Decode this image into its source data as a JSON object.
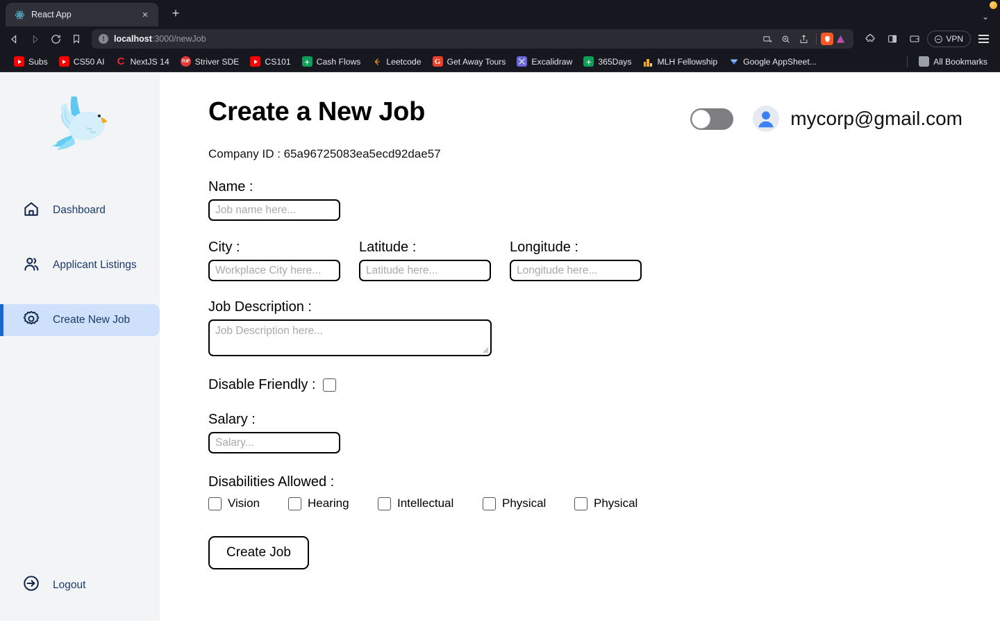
{
  "browser": {
    "tab": {
      "title": "React App",
      "favicon": "react-icon",
      "close_label": "×"
    },
    "new_tab_label": "+",
    "tabstrip_chevron": "⌄",
    "nav": {
      "back": "back-arrow-icon",
      "forward": "forward-arrow-icon",
      "reload": "reload-icon",
      "bookmark": "bookmark-icon"
    },
    "url": {
      "host": "localhost",
      "path": ":3000/newJob",
      "info_glyph": "!"
    },
    "vpn_label": "VPN",
    "bookmarks": [
      {
        "label": "Subs",
        "icon": "youtube-icon"
      },
      {
        "label": "CS50 AI",
        "icon": "youtube-icon"
      },
      {
        "label": "NextJS 14",
        "icon": "coursera-icon"
      },
      {
        "label": "Striver SDE",
        "icon": "takeuforward-icon"
      },
      {
        "label": "CS101",
        "icon": "youtube-icon"
      },
      {
        "label": "Cash Flows",
        "icon": "google-sheets-icon"
      },
      {
        "label": "Leetcode",
        "icon": "leetcode-icon"
      },
      {
        "label": "Get Away Tours",
        "icon": "gmail-icon"
      },
      {
        "label": "Excalidraw",
        "icon": "excalidraw-icon"
      },
      {
        "label": "365Days",
        "icon": "google-sheets-icon"
      },
      {
        "label": "MLH Fellowship",
        "icon": "mlh-icon"
      },
      {
        "label": "Google AppSheet...",
        "icon": "appsheet-icon"
      }
    ],
    "all_bookmarks_label": "All Bookmarks"
  },
  "sidebar": {
    "logo": "dove-logo",
    "items": [
      {
        "label": "Dashboard",
        "icon": "home-icon",
        "active": false
      },
      {
        "label": "Applicant Listings",
        "icon": "people-icon",
        "active": false
      },
      {
        "label": "Create New Job",
        "icon": "gear-icon",
        "active": true
      }
    ],
    "logout": {
      "label": "Logout",
      "icon": "logout-icon"
    },
    "accent": "#1967d2",
    "active_bg": "#cfe0fb",
    "text_color": "#1b3a6b"
  },
  "header": {
    "title": "Create a New Job",
    "company_id": "Company ID : 65a96725083ea5ecd92dae57",
    "toggle": {
      "state": "off",
      "track_color": "#7e7e82"
    },
    "user": {
      "email": "mycorp@gmail.com",
      "avatar": "user-avatar-icon"
    }
  },
  "form": {
    "name": {
      "label": "Name :",
      "value": "",
      "placeholder": "Job name here..."
    },
    "city": {
      "label": "City :",
      "value": "",
      "placeholder": "Workplace City here..."
    },
    "latitude": {
      "label": "Latitude :",
      "value": "",
      "placeholder": "Latitude here..."
    },
    "longitude": {
      "label": "Longitude :",
      "value": "",
      "placeholder": "Longitude here..."
    },
    "description": {
      "label": "Job Description :",
      "value": "",
      "placeholder": "Job Description here..."
    },
    "disable_friendly": {
      "label": "Disable Friendly :",
      "checked": false
    },
    "salary": {
      "label": "Salary :",
      "value": "",
      "placeholder": "Salary..."
    },
    "disabilities": {
      "label": "Disabilities Allowed :",
      "options": [
        {
          "label": "Vision",
          "checked": false
        },
        {
          "label": "Hearing",
          "checked": false
        },
        {
          "label": "Intellectual",
          "checked": false
        },
        {
          "label": "Physical",
          "checked": false
        },
        {
          "label": "Physical",
          "checked": false
        }
      ]
    },
    "submit_label": "Create Job"
  }
}
